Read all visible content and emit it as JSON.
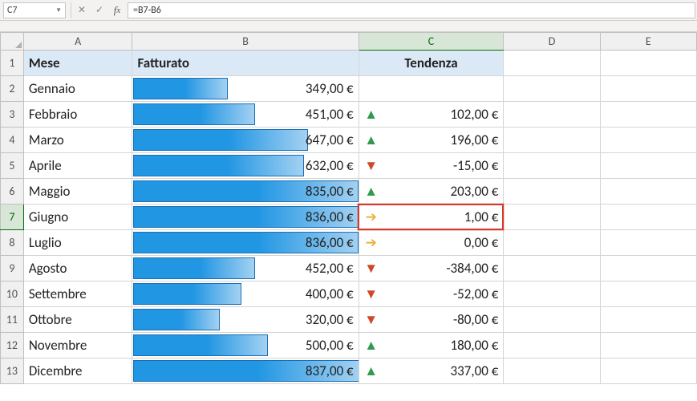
{
  "formula_bar": {
    "name_box": "C7",
    "formula": "=B7-B6"
  },
  "columns": [
    "A",
    "B",
    "C",
    "D",
    "E"
  ],
  "header": {
    "mese": "Mese",
    "fatturato": "Fatturato",
    "tendenza": "Tendenza"
  },
  "max_fatturato": 837,
  "rows": [
    {
      "n": 2,
      "mese": "Gennaio",
      "fatt_num": 349,
      "fatt": "349,00 €",
      "trend_icon": "",
      "trend": ""
    },
    {
      "n": 3,
      "mese": "Febbraio",
      "fatt_num": 451,
      "fatt": "451,00 €",
      "trend_icon": "up",
      "trend": "102,00 €"
    },
    {
      "n": 4,
      "mese": "Marzo",
      "fatt_num": 647,
      "fatt": "647,00 €",
      "trend_icon": "up",
      "trend": "196,00 €"
    },
    {
      "n": 5,
      "mese": "Aprile",
      "fatt_num": 632,
      "fatt": "632,00 €",
      "trend_icon": "down",
      "trend": "-15,00 €"
    },
    {
      "n": 6,
      "mese": "Maggio",
      "fatt_num": 835,
      "fatt": "835,00 €",
      "trend_icon": "up",
      "trend": "203,00 €"
    },
    {
      "n": 7,
      "mese": "Giugno",
      "fatt_num": 836,
      "fatt": "836,00 €",
      "trend_icon": "flat",
      "trend": "1,00 €"
    },
    {
      "n": 8,
      "mese": "Luglio",
      "fatt_num": 836,
      "fatt": "836,00 €",
      "trend_icon": "flat",
      "trend": "0,00 €"
    },
    {
      "n": 9,
      "mese": "Agosto",
      "fatt_num": 452,
      "fatt": "452,00 €",
      "trend_icon": "down",
      "trend": "-384,00 €"
    },
    {
      "n": 10,
      "mese": "Settembre",
      "fatt_num": 400,
      "fatt": "400,00 €",
      "trend_icon": "down",
      "trend": "-52,00 €"
    },
    {
      "n": 11,
      "mese": "Ottobre",
      "fatt_num": 320,
      "fatt": "320,00 €",
      "trend_icon": "down",
      "trend": "-80,00 €"
    },
    {
      "n": 12,
      "mese": "Novembre",
      "fatt_num": 500,
      "fatt": "500,00 €",
      "trend_icon": "up",
      "trend": "180,00 €"
    },
    {
      "n": 13,
      "mese": "Dicembre",
      "fatt_num": 837,
      "fatt": "837,00 €",
      "trend_icon": "up",
      "trend": "337,00 €"
    }
  ],
  "selected_cell": {
    "row": 7,
    "col": "C"
  },
  "chart_data": {
    "type": "bar",
    "title": "Fatturato",
    "categories": [
      "Gennaio",
      "Febbraio",
      "Marzo",
      "Aprile",
      "Maggio",
      "Giugno",
      "Luglio",
      "Agosto",
      "Settembre",
      "Ottobre",
      "Novembre",
      "Dicembre"
    ],
    "values": [
      349,
      451,
      647,
      632,
      835,
      836,
      836,
      452,
      400,
      320,
      500,
      837
    ],
    "ylabel": "€",
    "xlabel": "Mese",
    "ylim": [
      0,
      837
    ]
  }
}
